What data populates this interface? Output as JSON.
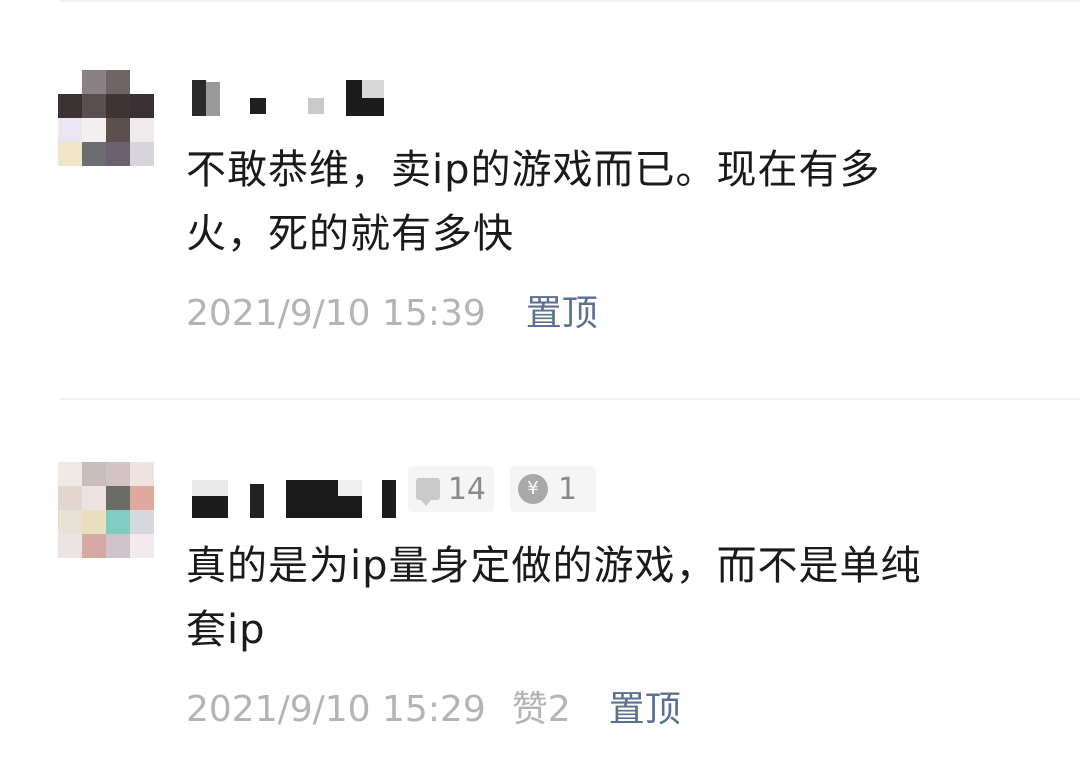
{
  "comments": [
    {
      "text_line1": "不敢恭维，卖ip的游戏而已。现在有多",
      "text_line2": "火，死的就有多快",
      "timestamp": "2021/9/10 15:39",
      "pin_label": "置顶"
    },
    {
      "text_line1": "真的是为ip量身定做的游戏，而不是单纯",
      "text_line2": "套ip",
      "timestamp": "2021/9/10 15:29",
      "likes_label": "赞2",
      "pin_label": "置顶",
      "reply_count": "14",
      "coin_count": "1",
      "coin_symbol": "¥"
    }
  ],
  "icons": {
    "reply": "speech-bubble-icon",
    "coin": "yuan-coin-icon"
  },
  "colors": {
    "text": "#1a1a1a",
    "meta": "#b4b4b4",
    "pin": "#5b6f92",
    "divider": "#f0f0f0"
  }
}
